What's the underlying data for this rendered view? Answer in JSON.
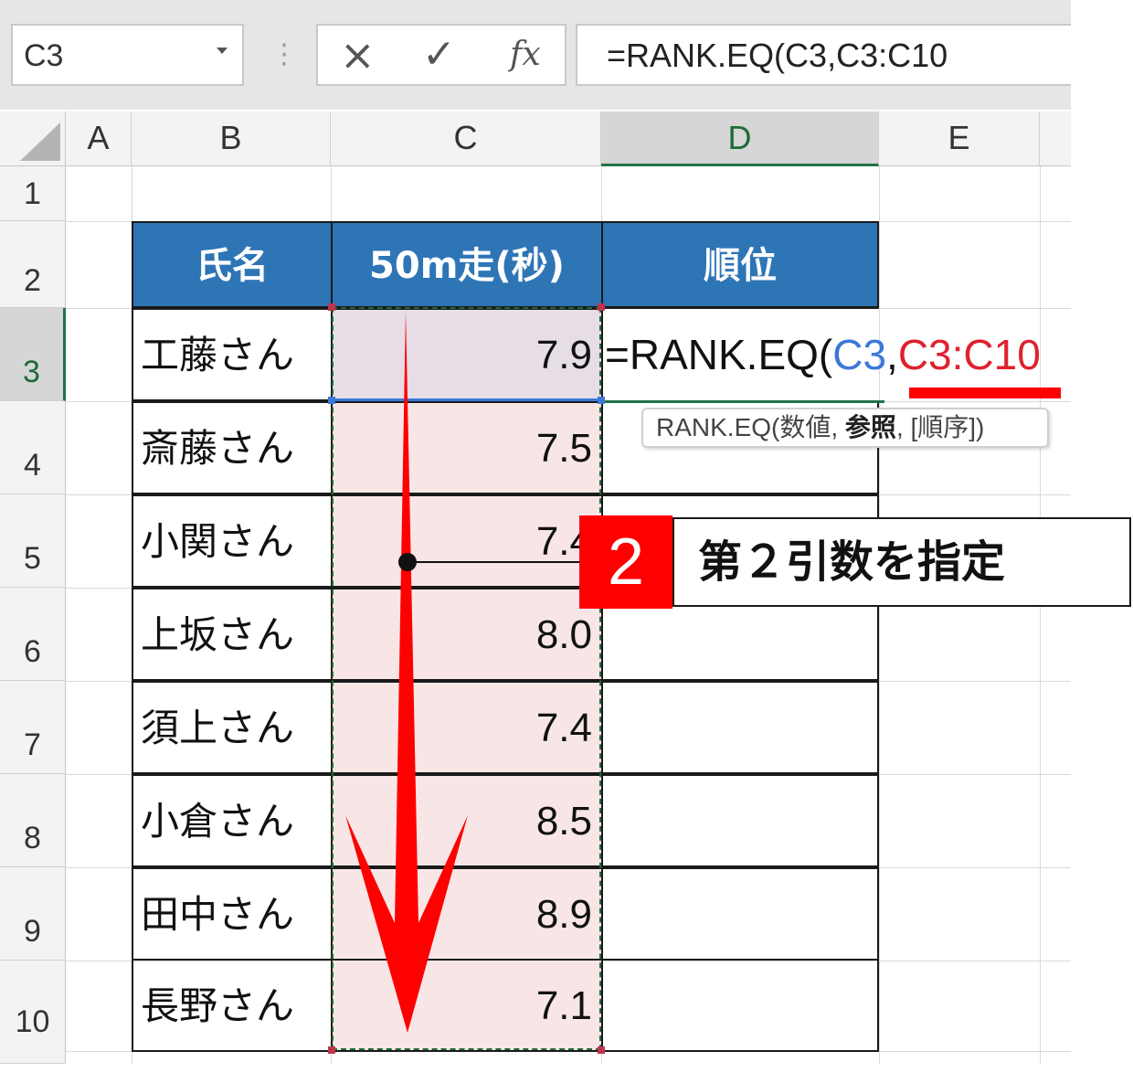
{
  "formula_bar": {
    "name_box": "C3",
    "cancel_icon": "×",
    "enter_icon": "✓",
    "fx_label": "fx",
    "formula": "=RANK.EQ(C3,C3:C10"
  },
  "columns": [
    "A",
    "B",
    "C",
    "D",
    "E"
  ],
  "rows": [
    "1",
    "2",
    "3",
    "4",
    "5",
    "6",
    "7",
    "8",
    "9",
    "10"
  ],
  "table": {
    "headers": [
      "氏名",
      "50m走(秒)",
      "順位"
    ],
    "rows": [
      {
        "name": "工藤さん",
        "time": "7.9"
      },
      {
        "name": "斎藤さん",
        "time": "7.5"
      },
      {
        "name": "小関さん",
        "time": "7.4"
      },
      {
        "name": "上坂さん",
        "time": "8.0"
      },
      {
        "name": "須上さん",
        "time": "7.4"
      },
      {
        "name": "小倉さん",
        "time": "8.5"
      },
      {
        "name": "田中さん",
        "time": "8.9"
      },
      {
        "name": "長野さん",
        "time": "7.1"
      }
    ]
  },
  "cell_edit": {
    "prefix": "=RANK.EQ(",
    "arg1": "C3",
    "comma": ",",
    "arg2": "C3:C10"
  },
  "tooltip": {
    "func": "RANK.EQ(",
    "arg1": "数値, ",
    "arg2": "参照",
    "rest": ", [順序])"
  },
  "callout": {
    "number": "2",
    "text": "第２引数を指定"
  },
  "colors": {
    "header_blue": "#2e75b6",
    "arg1_blue": "#3c78d8",
    "arg2_red": "#e0202e",
    "callout_red": "#ff0000",
    "range_fill": "#f8e6e7",
    "excel_green": "#217346"
  }
}
